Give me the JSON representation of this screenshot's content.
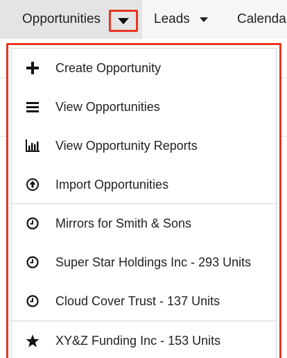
{
  "nav": {
    "opportunities_label": "Opportunities",
    "leads_label": "Leads",
    "calendar_label": "Calenda"
  },
  "menu": {
    "items": [
      {
        "label": "Create Opportunity",
        "icon": "plus-icon"
      },
      {
        "label": "View Opportunities",
        "icon": "list-icon"
      },
      {
        "label": "View Opportunity Reports",
        "icon": "bar-chart-icon"
      },
      {
        "label": "Import Opportunities",
        "icon": "upload-circle-icon"
      },
      {
        "label": "Mirrors for Smith & Sons",
        "icon": "clock-icon"
      },
      {
        "label": "Super Star Holdings Inc - 293 Units",
        "icon": "clock-icon"
      },
      {
        "label": "Cloud Cover Trust - 137 Units",
        "icon": "clock-icon"
      },
      {
        "label": "XY&Z Funding Inc - 153 Units",
        "icon": "star-icon"
      }
    ]
  },
  "colors": {
    "highlight": "#e8341f",
    "nav_background": "#f6f6f6",
    "active_tab": "#e4e4e4"
  }
}
